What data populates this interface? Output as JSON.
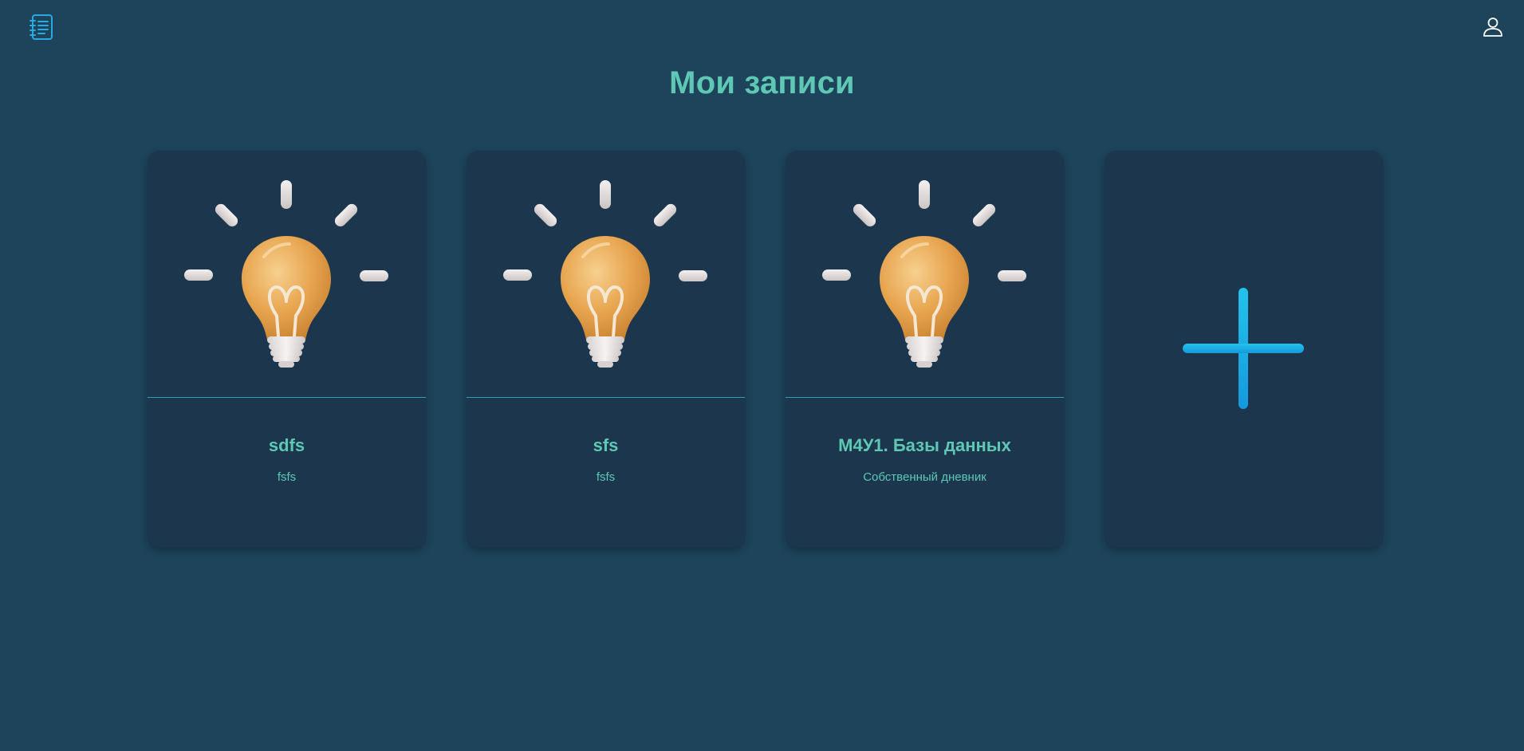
{
  "header": {
    "logo_icon": "notebook-icon",
    "user_icon": "user-icon",
    "accent_color": "#29a9e0"
  },
  "page": {
    "title": "Мои записи"
  },
  "entries": [
    {
      "title": "sdfs",
      "description": "fsfs",
      "image_icon": "lightbulb-icon"
    },
    {
      "title": "sfs",
      "description": "fsfs",
      "image_icon": "lightbulb-icon"
    },
    {
      "title": "М4У1. Базы данных",
      "description": "Собственный дневник",
      "image_icon": "lightbulb-icon"
    }
  ],
  "add_card": {
    "icon": "plus-icon"
  },
  "colors": {
    "background": "#1d445a",
    "card": "#1b364d",
    "text_accent": "#5fc8b4",
    "divider": "#2ea0bf",
    "plus": "#1fb3e8"
  }
}
